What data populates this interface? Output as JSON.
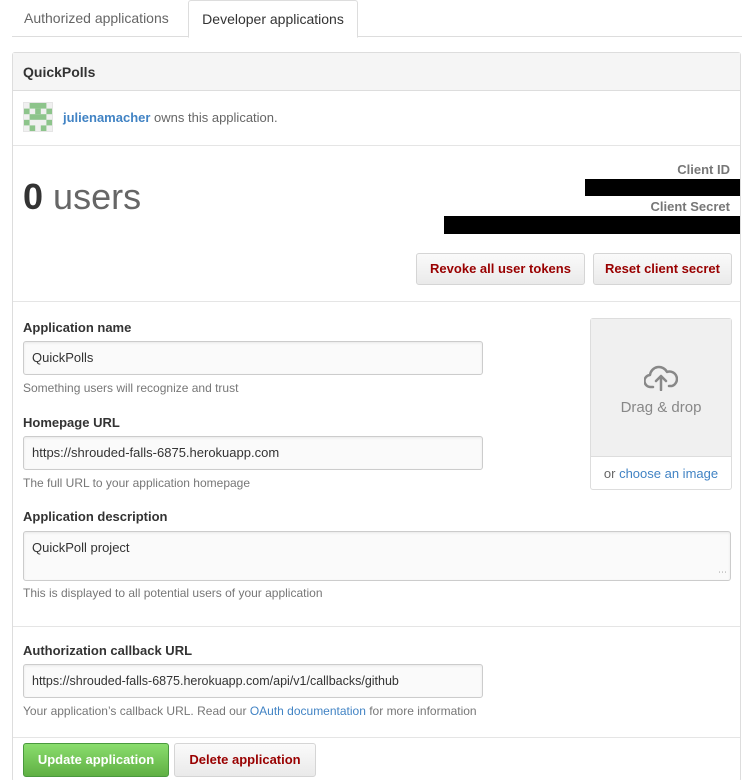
{
  "tabs": [
    {
      "label": "Authorized applications"
    },
    {
      "label": "Developer applications"
    }
  ],
  "app": {
    "name": "QuickPolls",
    "owner": "julienamacher",
    "owner_suffix": " owns this application."
  },
  "stats": {
    "user_count": "0",
    "user_label": "users",
    "client_id_label": "Client ID",
    "client_secret_label": "Client Secret"
  },
  "actions": {
    "revoke_label": "Revoke all user tokens",
    "reset_label": "Reset client secret"
  },
  "form": {
    "name_label": "Application name",
    "name_value": "QuickPolls",
    "name_note": "Something users will recognize and trust",
    "homepage_label": "Homepage URL",
    "homepage_value": "https://shrouded-falls-6875.herokuapp.com",
    "homepage_note": "The full URL to your application homepage",
    "description_label": "Application description",
    "description_value": "QuickPoll project",
    "description_note": "This is displayed to all potential users of your application",
    "callback_label": "Authorization callback URL",
    "callback_value": "https://shrouded-falls-6875.herokuapp.com/api/v1/callbacks/github",
    "callback_note_prefix": "Your application’s callback URL. Read our ",
    "callback_note_link": "OAuth documentation",
    "callback_note_suffix": " for more information"
  },
  "upload": {
    "icon": "cloud-upload-icon",
    "drag_text": "Drag & drop",
    "or_text": "or ",
    "choose_link": "choose an image"
  },
  "footer": {
    "update_label": "Update application",
    "delete_label": "Delete application"
  },
  "colors": {
    "link": "#4183c4",
    "danger": "#990000",
    "primary": "#60b044"
  }
}
